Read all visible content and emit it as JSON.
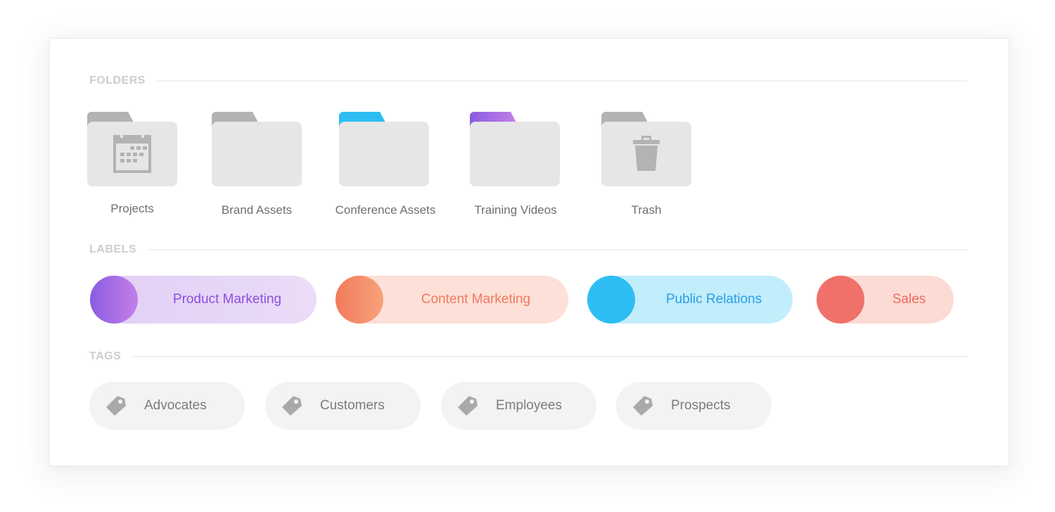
{
  "sections": {
    "folders_title": "FOLDERS",
    "labels_title": "LABELS",
    "tags_title": "TAGS"
  },
  "folders": [
    {
      "name": "Projects",
      "tab_color": "#b3b3b3",
      "icon": "calendar-icon"
    },
    {
      "name": "Brand Assets",
      "tab_color": "#b3b3b3",
      "icon": null
    },
    {
      "name": "Conference Assets",
      "tab_color": "#2ebdf3",
      "icon": null
    },
    {
      "name": "Training Videos",
      "tab_color": "linear-gradient(90deg,#8a5ce2,#c47fe8)",
      "icon": null
    },
    {
      "name": "Trash",
      "tab_color": "#b3b3b3",
      "icon": "trash-icon"
    }
  ],
  "labels": [
    {
      "name": "Product Marketing",
      "dot_color": "linear-gradient(90deg,#8a5ce2,#c47fe8)",
      "bg_color": "linear-gradient(90deg,#e1cff6,#ebdcf7)",
      "text_color": "#8a4fe0"
    },
    {
      "name": "Content Marketing",
      "dot_color": "linear-gradient(90deg,#f27a5c,#f7a27a)",
      "bg_color": "#fde0d7",
      "text_color": "#ef7a5e"
    },
    {
      "name": "Public Relations",
      "dot_color": "#2ebdf3",
      "bg_color": "#c2edfb",
      "text_color": "#2a9ee3"
    },
    {
      "name": "Sales",
      "dot_color": "#f0706a",
      "bg_color": "#fcdbd5",
      "text_color": "#ed6a62"
    }
  ],
  "tags": [
    {
      "name": "Advocates",
      "icon": "tag-icon"
    },
    {
      "name": "Customers",
      "icon": "tag-icon"
    },
    {
      "name": "Employees",
      "icon": "tag-icon"
    },
    {
      "name": "Prospects",
      "icon": "tag-icon"
    }
  ]
}
